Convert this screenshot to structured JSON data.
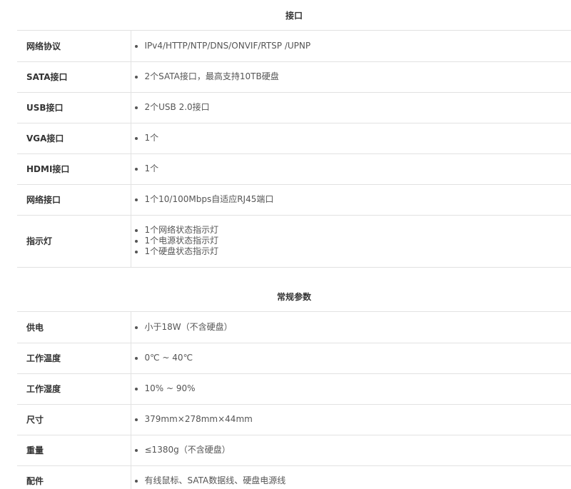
{
  "sections": [
    {
      "title": "接口",
      "rows": [
        {
          "label": "网络协议",
          "items": [
            "IPv4/HTTP/NTP/DNS/ONVIF/RTSP /UPNP"
          ]
        },
        {
          "label": "SATA接口",
          "items": [
            "2个SATA接口，最高支持10TB硬盘"
          ]
        },
        {
          "label": "USB接口",
          "items": [
            "2个USB 2.0接口"
          ]
        },
        {
          "label": "VGA接口",
          "items": [
            "1个"
          ]
        },
        {
          "label": "HDMI接口",
          "items": [
            "1个"
          ]
        },
        {
          "label": "网络接口",
          "items": [
            "1个10/100Mbps自适应RJ45端口"
          ]
        },
        {
          "label": "指示灯",
          "items": [
            "1个网络状态指示灯",
            "1个电源状态指示灯",
            "1个硬盘状态指示灯"
          ]
        }
      ]
    },
    {
      "title": "常规参数",
      "rows": [
        {
          "label": "供电",
          "items": [
            "小于18W（不含硬盘）"
          ]
        },
        {
          "label": "工作温度",
          "items": [
            "0℃ ~ 40℃"
          ]
        },
        {
          "label": "工作湿度",
          "items": [
            "10% ~ 90%"
          ]
        },
        {
          "label": "尺寸",
          "items": [
            "379mm×278mm×44mm"
          ]
        },
        {
          "label": "重量",
          "items": [
            "≤1380g（不含硬盘）"
          ]
        },
        {
          "label": "配件",
          "items": [
            "有线鼠标、SATA数据线、硬盘电源线"
          ]
        }
      ]
    }
  ]
}
